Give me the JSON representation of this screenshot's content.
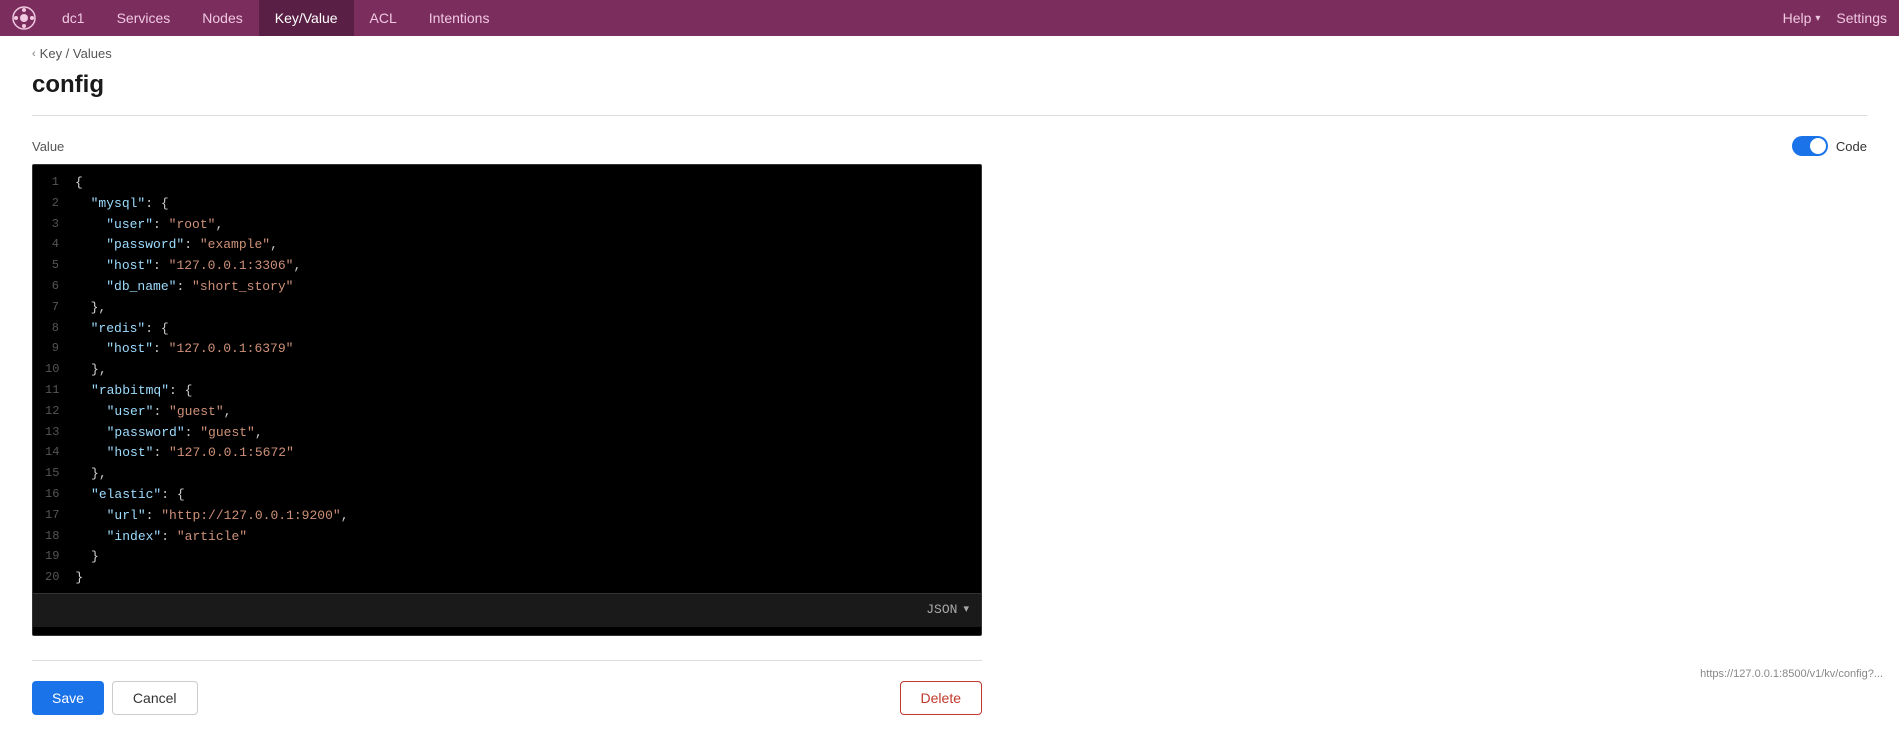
{
  "nav": {
    "logo_alt": "Consul",
    "dc_label": "dc1",
    "items": [
      {
        "label": "Services",
        "active": false
      },
      {
        "label": "Nodes",
        "active": false
      },
      {
        "label": "Key/Value",
        "active": true
      },
      {
        "label": "ACL",
        "active": false
      },
      {
        "label": "Intentions",
        "active": false
      }
    ],
    "right": [
      {
        "label": "Help",
        "has_chevron": true
      },
      {
        "label": "Settings",
        "has_chevron": false
      }
    ]
  },
  "breadcrumb": {
    "back_label": "Key / Values"
  },
  "page": {
    "title": "config"
  },
  "value_section": {
    "label": "Value",
    "code_toggle_label": "Code",
    "code_lines": [
      {
        "num": 1,
        "content": "{"
      },
      {
        "num": 2,
        "content": "  \"mysql\": {"
      },
      {
        "num": 3,
        "content": "    \"user\": \"root\","
      },
      {
        "num": 4,
        "content": "    \"password\": \"example\","
      },
      {
        "num": 5,
        "content": "    \"host\": \"127.0.0.1:3306\","
      },
      {
        "num": 6,
        "content": "    \"db_name\": \"short_story\""
      },
      {
        "num": 7,
        "content": "  },"
      },
      {
        "num": 8,
        "content": "  \"redis\": {"
      },
      {
        "num": 9,
        "content": "    \"host\": \"127.0.0.1:6379\""
      },
      {
        "num": 10,
        "content": "  },"
      },
      {
        "num": 11,
        "content": "  \"rabbitmq\": {"
      },
      {
        "num": 12,
        "content": "    \"user\": \"guest\","
      },
      {
        "num": 13,
        "content": "    \"password\": \"guest\","
      },
      {
        "num": 14,
        "content": "    \"host\": \"127.0.0.1:5672\""
      },
      {
        "num": 15,
        "content": "  },"
      },
      {
        "num": 16,
        "content": "  \"elastic\": {"
      },
      {
        "num": 17,
        "content": "    \"url\": \"http://127.0.0.1:9200\","
      },
      {
        "num": 18,
        "content": "    \"index\": \"article\""
      },
      {
        "num": 19,
        "content": "  }"
      },
      {
        "num": 20,
        "content": "}"
      }
    ],
    "code_mode": "JSON"
  },
  "buttons": {
    "save": "Save",
    "cancel": "Cancel",
    "delete": "Delete"
  },
  "footer_url": "https://127.0.0.1:8500/v1/kv/config?..."
}
